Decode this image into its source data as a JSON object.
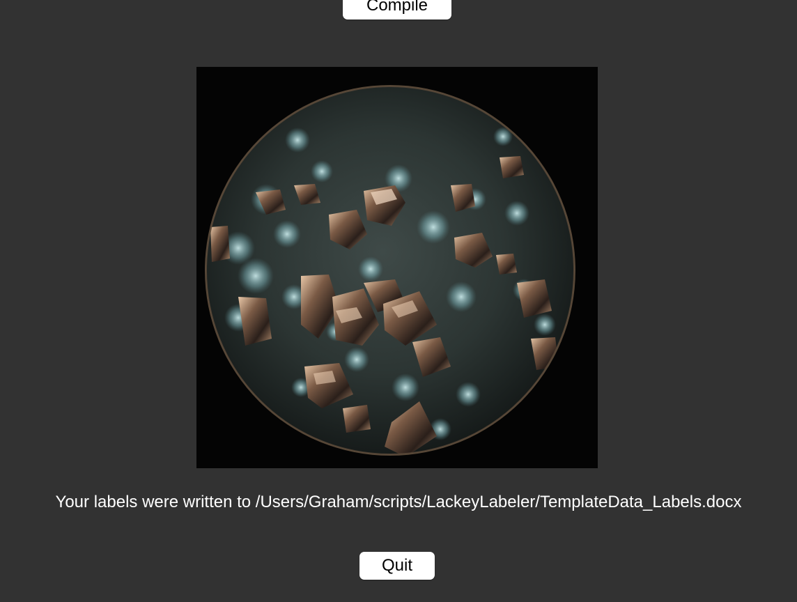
{
  "buttons": {
    "compile_label": "Compile",
    "quit_label": "Quit"
  },
  "image": {
    "subject": "crystals-under-microscope"
  },
  "status": {
    "message": "Your labels were written to /Users/Graham/scripts/LackeyLabeler/TemplateData_Labels.docx"
  },
  "colors": {
    "background": "#323232",
    "button_bg": "#ffffff",
    "text": "#ffffff"
  }
}
